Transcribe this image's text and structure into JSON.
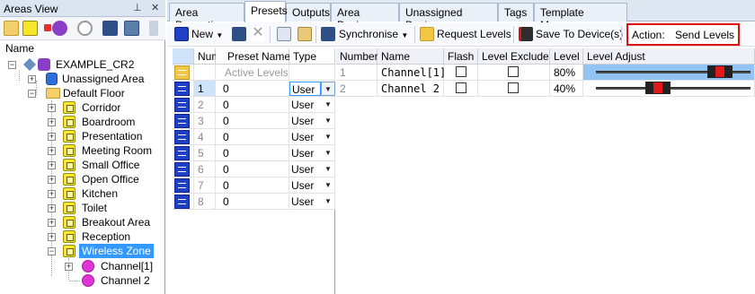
{
  "areas_view": {
    "title": "Areas View",
    "pin_glyph": "⊥",
    "close_glyph": "✕",
    "name_header": "Name",
    "toolbar_icons": [
      "add-area-icon",
      "add-item-icon",
      "device-icon",
      "block-icon",
      "find-icon",
      "calculator-icon",
      "overflow-icon"
    ],
    "tree": {
      "root": "EXAMPLE_CR2",
      "unassigned": "Unassigned Area",
      "floor": "Default Floor",
      "areas": [
        "Corridor",
        "Boardroom",
        "Presentation",
        "Meeting Room",
        "Small Office",
        "Open Office",
        "Kitchen",
        "Toilet",
        "Breakout Area",
        "Reception",
        "Wireless Zone"
      ],
      "selected_area": "Wireless Zone",
      "channels": [
        "Channel[1]",
        "Channel 2"
      ]
    }
  },
  "tabs": [
    "Area Properties",
    "Presets",
    "Outputs",
    "Area Devices",
    "Unassigned Devices",
    "Tags",
    "Template Manager"
  ],
  "active_tab": "Presets",
  "toolbar": {
    "new_label": "New",
    "synchronise_label": "Synchronise",
    "request_levels_label": "Request Levels",
    "save_to_devices_label": "Save To Device(s)",
    "action_label": "Action:",
    "action_value": "Send Levels"
  },
  "presets_table": {
    "columns": [
      "Num",
      "Preset Name",
      "Type"
    ],
    "active_levels_label": "Active Levels",
    "rows": [
      {
        "num": "1",
        "name": "0",
        "type": "User"
      },
      {
        "num": "2",
        "name": "0",
        "type": "User"
      },
      {
        "num": "3",
        "name": "0",
        "type": "User"
      },
      {
        "num": "4",
        "name": "0",
        "type": "User"
      },
      {
        "num": "5",
        "name": "0",
        "type": "User"
      },
      {
        "num": "6",
        "name": "0",
        "type": "User"
      },
      {
        "num": "7",
        "name": "0",
        "type": "User"
      },
      {
        "num": "8",
        "name": "0",
        "type": "User"
      }
    ]
  },
  "channels_table": {
    "columns": [
      "Number",
      "Name",
      "Flash",
      "Level Exclude",
      "Level",
      "Level Adjust"
    ],
    "rows": [
      {
        "number": "1",
        "name": "Channel[1]",
        "level": "80%",
        "level_value": 0.8
      },
      {
        "number": "2",
        "name": "Channel 2",
        "level": "40%",
        "level_value": 0.4
      }
    ]
  },
  "colors": {
    "selection": "#3399ff",
    "preset_icon": "#1f3fc7",
    "highlight_box": "#e01010"
  }
}
